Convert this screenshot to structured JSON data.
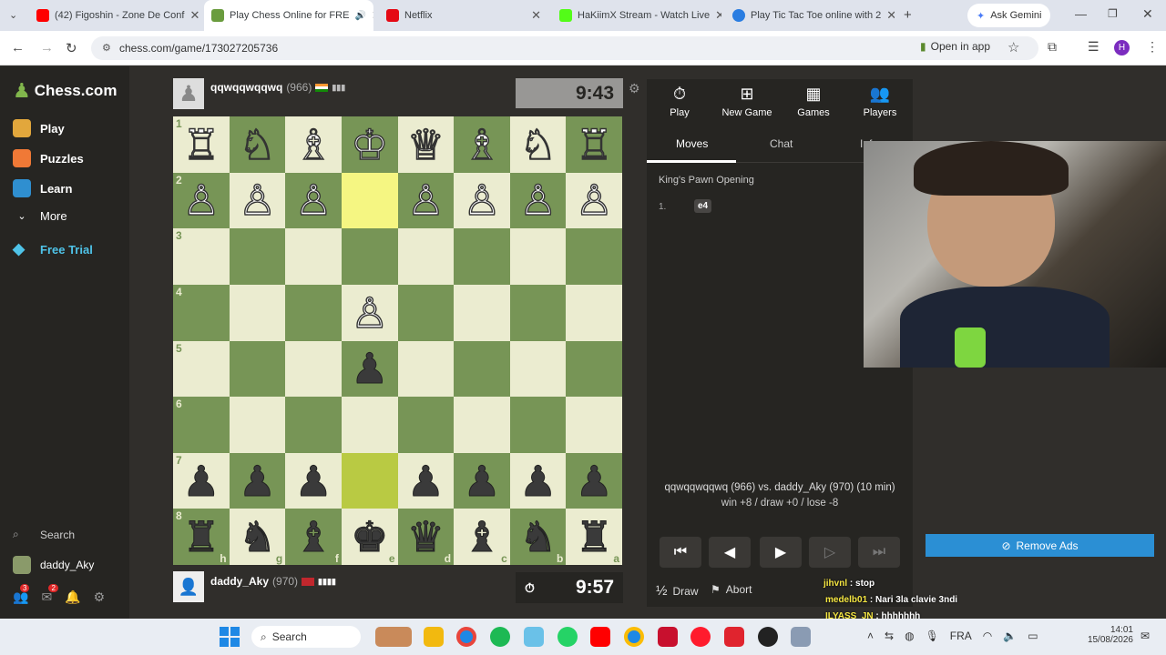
{
  "browser": {
    "tabs": [
      {
        "title": "(42) Figoshin - Zone De Conf",
        "color": "#ff0000"
      },
      {
        "title": "Play Chess Online for FRE",
        "color": "#6a9c3e"
      },
      {
        "title": "Netflix",
        "color": "#e50914"
      },
      {
        "title": "HaKiimX Stream - Watch Live",
        "color": "#53fc18"
      },
      {
        "title": "Play Tic Tac Toe online with 2",
        "color": "#2a7de1"
      }
    ],
    "gemini": "Ask Gemini",
    "url": "chess.com/game/173027205736",
    "open_in_app": "Open in app",
    "avatar_letter": "H"
  },
  "sidebar": {
    "logo": "Chess.com",
    "items": [
      "Play",
      "Puzzles",
      "Learn",
      "More",
      "Free Trial"
    ],
    "search": "Search",
    "username": "daddy_Aky",
    "badges": {
      "notif": "3",
      "mail": "2"
    }
  },
  "top_player": {
    "name": "qqwqqwqqwq",
    "rating": "(966)",
    "clock": "9:43"
  },
  "bottom_player": {
    "name": "daddy_Aky",
    "rating": "(970)",
    "clock": "9:57"
  },
  "board": {
    "rows": [
      [
        "♖",
        "♘",
        "♗",
        "♔",
        "♕",
        "♗",
        "♘",
        "♖"
      ],
      [
        "♙",
        "♙",
        "♙",
        "",
        "♙",
        "♙",
        "♙",
        "♙"
      ],
      [
        "",
        "",
        "",
        "",
        "",
        "",
        "",
        ""
      ],
      [
        "",
        "",
        "",
        "♙",
        "",
        "",
        "",
        ""
      ],
      [
        "",
        "",
        "",
        "♟",
        "",
        "",
        "",
        ""
      ],
      [
        "",
        "",
        "",
        "",
        "",
        "",
        "",
        ""
      ],
      [
        "♟",
        "♟",
        "♟",
        "",
        "♟",
        "♟",
        "♟",
        "♟"
      ],
      [
        "♜",
        "♞",
        "♝",
        "♚",
        "♛",
        "♝",
        "♞",
        "♜"
      ]
    ],
    "ranks": [
      "1",
      "2",
      "3",
      "4",
      "5",
      "6",
      "7",
      "8"
    ],
    "files": [
      "h",
      "g",
      "f",
      "e",
      "d",
      "c",
      "b",
      "a"
    ]
  },
  "panel": {
    "buttons": [
      "Play",
      "New Game",
      "Games",
      "Players"
    ],
    "tabs": [
      "Moves",
      "Chat",
      "Info"
    ],
    "opening": "King's Pawn Opening",
    "move_number": "1.",
    "move": "e4",
    "matchup": "qqwqqwqqwq (966) vs. daddy_Aky (970) (10 min)",
    "record": "win +8 / draw +0 / lose -8",
    "draw": "Draw",
    "abort": "Abort",
    "draw_symbol": "½"
  },
  "remove_ads": "Remove Ads",
  "chat_overlay": [
    {
      "user": "jihvnl",
      "text": "stop"
    },
    {
      "user": "medelb01",
      "text": "Nari 3la clavie 3ndi"
    },
    {
      "user": "ILYASS_JN",
      "text": "hhhhhhh"
    }
  ],
  "taskbar": {
    "search": "Search",
    "lang": "FRA",
    "time": "14:01",
    "date": "15/08/2026"
  }
}
